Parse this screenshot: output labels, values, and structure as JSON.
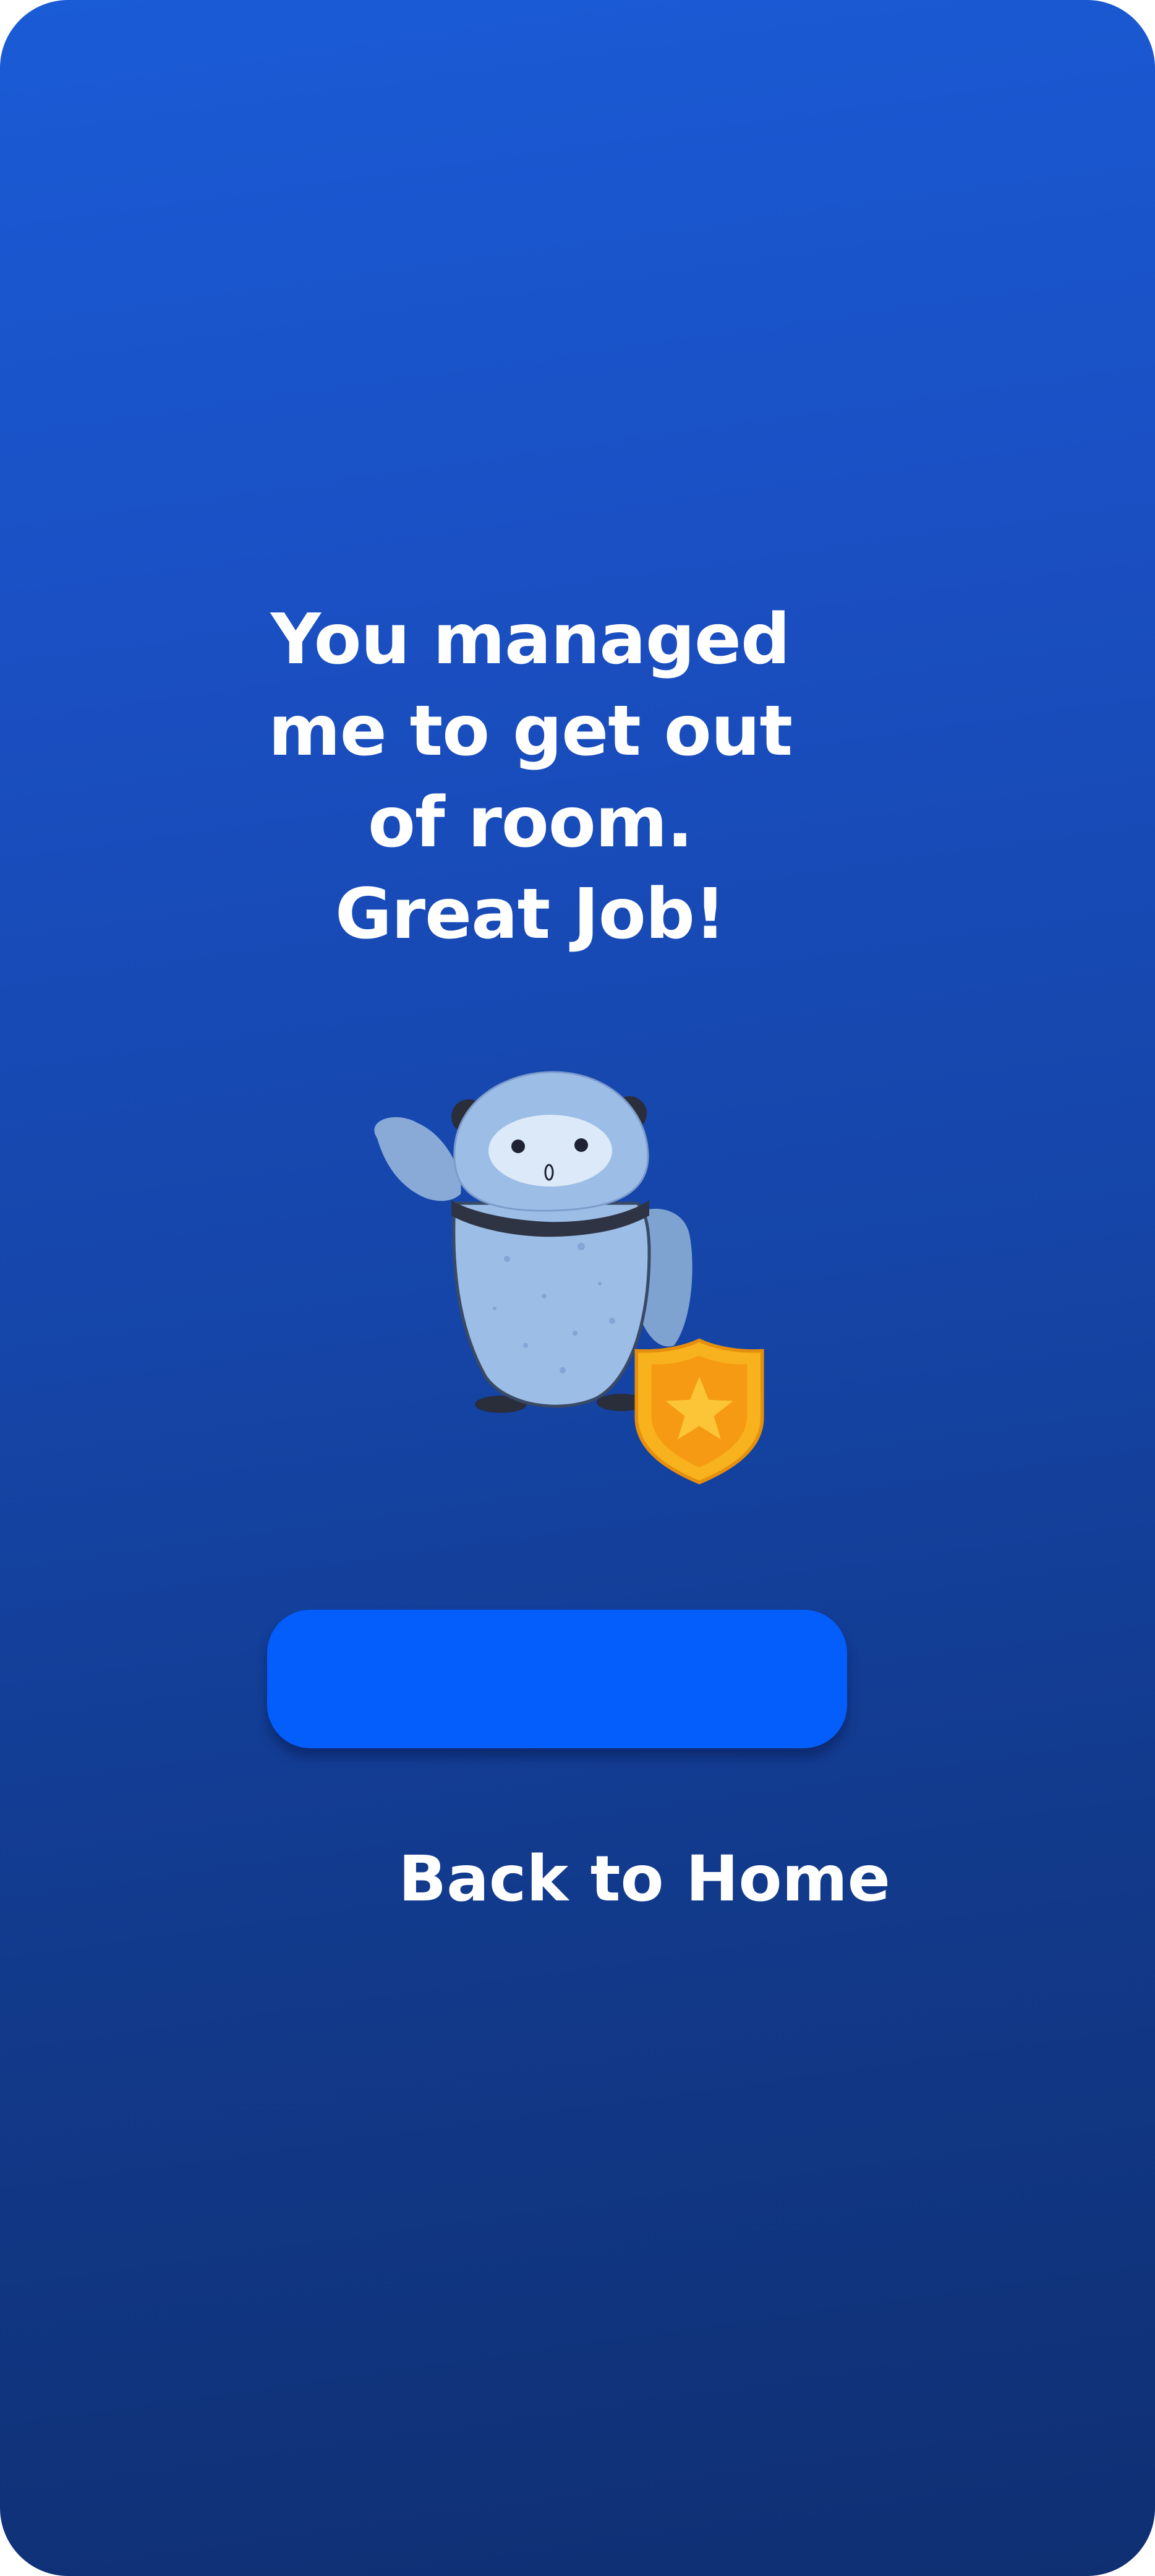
{
  "success_screen": {
    "message_lines": [
      "You managed",
      "me to get out",
      "of room.",
      "Great Job!"
    ],
    "primary_button_label": "",
    "back_link_label": "Back to Home"
  },
  "illustration": {
    "name": "robot-mascot-with-badge",
    "icon": "star-shield-badge-icon"
  },
  "colors": {
    "background_top": "#1a5bd6",
    "background_bottom": "#0f2f72",
    "button": "#045efc",
    "text": "#ffffff",
    "badge_outer": "#f7b21d",
    "badge_inner": "#f59a12",
    "robot_body": "#9bbde6"
  }
}
